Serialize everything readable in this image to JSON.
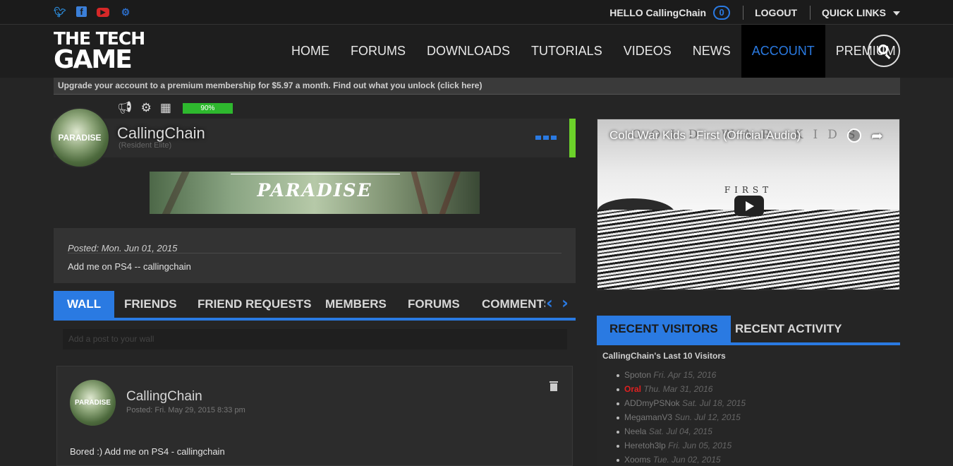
{
  "topbar": {
    "social": [
      "twitter-icon",
      "facebook-icon",
      "youtube-icon",
      "steam-icon"
    ],
    "hello": "HELLO CallingChain",
    "notifications": "0",
    "logout": "LOGOUT",
    "quick_links": "QUICK LINKS"
  },
  "header": {
    "logo_line1": "THE TECH",
    "logo_line2": "GAME",
    "nav": [
      "HOME",
      "FORUMS",
      "DOWNLOADS",
      "TUTORIALS",
      "VIDEOS",
      "NEWS",
      "ACCOUNT",
      "PREMIUM"
    ],
    "active_nav": "ACCOUNT"
  },
  "promo": "Upgrade your account to a premium membership for $5.97 a month. Find out what you unlock (click here)",
  "profile": {
    "progress": "90%",
    "avatar_text": "PARADISE",
    "name": "CallingChain",
    "title": "(Resident Elite)",
    "banner_text": "PARADISE",
    "status_date": "Posted: Mon. Jun 01, 2015",
    "status_text": "Add me on PS4 -- callingchain"
  },
  "tabs": [
    "WALL",
    "FRIENDS",
    "FRIEND REQUESTS",
    "MEMBERS",
    "FORUMS",
    "COMMENTS"
  ],
  "wall": {
    "placeholder": "Add a post to your wall",
    "post": {
      "avatar_text": "PARADISE",
      "author": "CallingChain",
      "time": "Posted: Fri. May 29, 2015 8:33 pm",
      "body": "Bored :) Add me on PS4 - callingchain"
    }
  },
  "video": {
    "title": "Cold War Kids - First (Official Audio)",
    "art_text": "COLD WAR KIDS",
    "art_subtitle": "FIRST"
  },
  "right_tabs": [
    "RECENT VISITORS",
    "RECENT ACTIVITY"
  ],
  "visitors": {
    "title": "CallingChain's Last 10 Visitors",
    "list": [
      {
        "name": "Spoton",
        "date": "Fri. Apr 15, 2016",
        "highlight": false
      },
      {
        "name": "Oral",
        "date": "Thu. Mar 31, 2016",
        "highlight": true
      },
      {
        "name": "ADDmyPSNok",
        "date": "Sat. Jul 18, 2015",
        "highlight": false
      },
      {
        "name": "MegamanV3",
        "date": "Sun. Jul 12, 2015",
        "highlight": false
      },
      {
        "name": "Neela",
        "date": "Sat. Jul 04, 2015",
        "highlight": false
      },
      {
        "name": "Heretoh3lp",
        "date": "Fri. Jun 05, 2015",
        "highlight": false
      },
      {
        "name": "Xooms",
        "date": "Tue. Jun 02, 2015",
        "highlight": false
      }
    ]
  },
  "colors": {
    "accent": "#2a7ae2",
    "progress": "#2eb82e",
    "status_bar": "#6cd12a",
    "highlight_name": "#e02020"
  }
}
